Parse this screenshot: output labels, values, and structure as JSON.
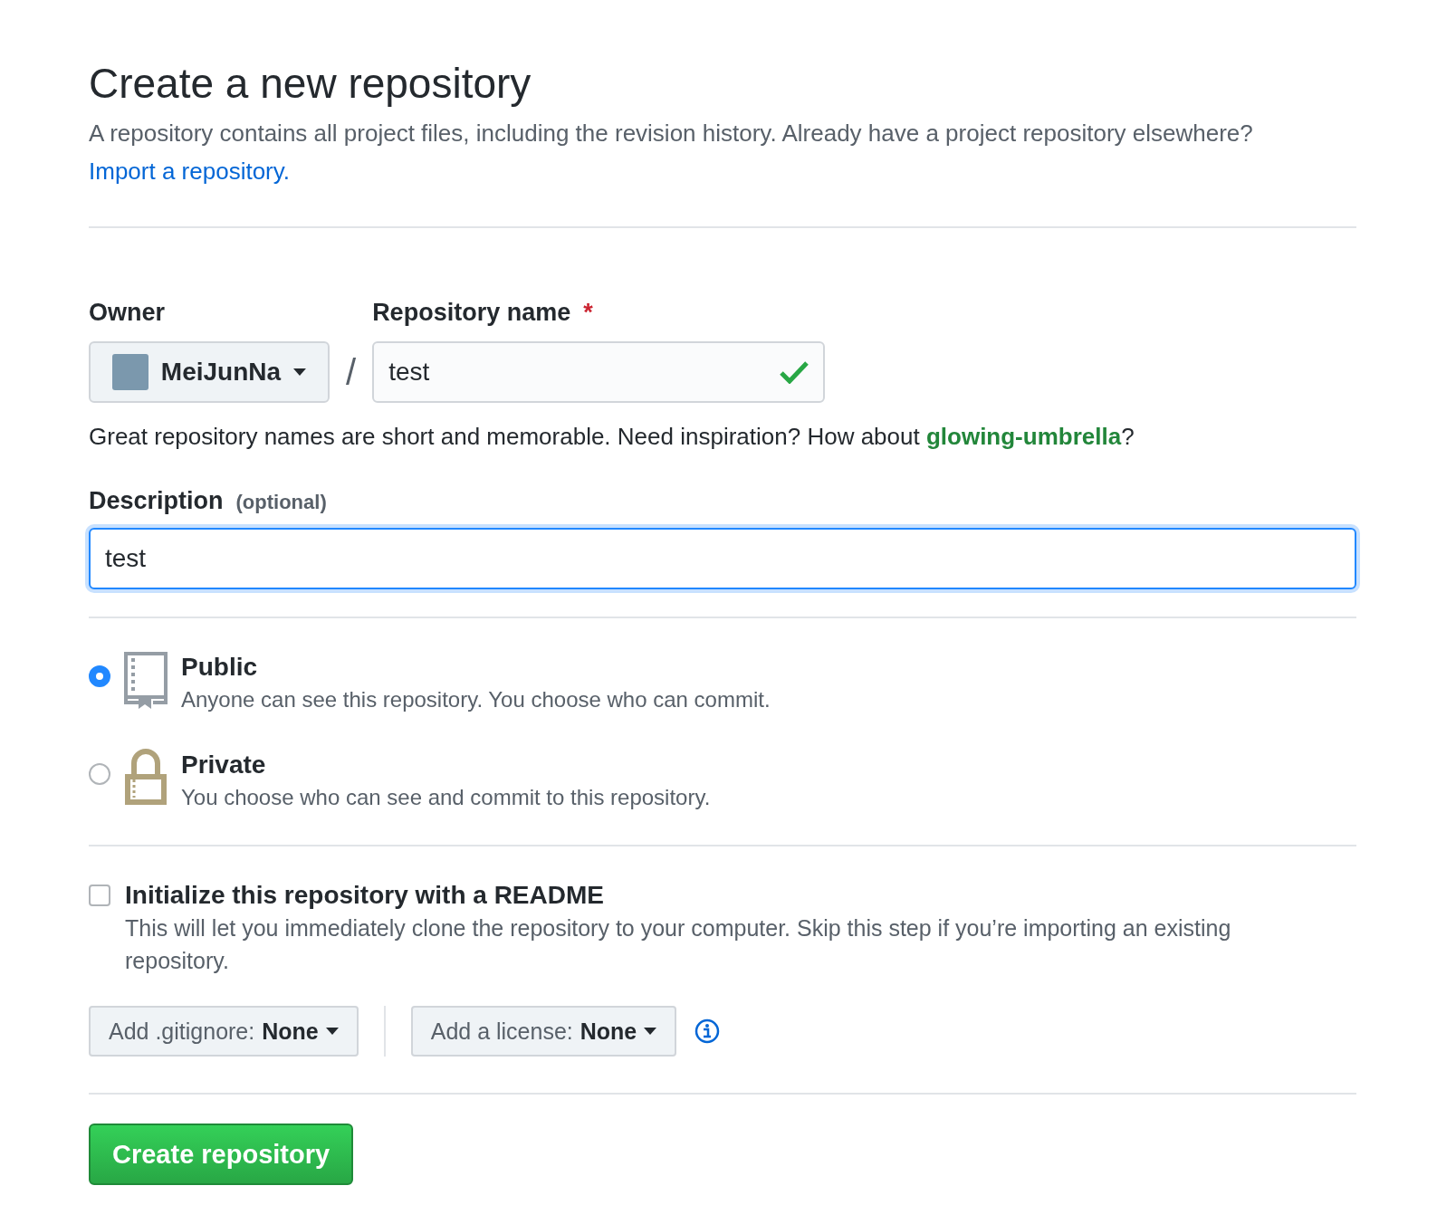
{
  "page": {
    "title": "Create a new repository",
    "intro": "A repository contains all project files, including the revision history. Already have a project repository elsewhere?",
    "import_link": "Import a repository."
  },
  "owner": {
    "label": "Owner",
    "value": "MeiJunNa"
  },
  "separator": "/",
  "repo_name": {
    "label": "Repository name",
    "required_mark": "*",
    "value": "test",
    "valid": true
  },
  "name_hint": "Great repository names are short and memorable. Need inspiration? How about **glowing-umbrella**?",
  "description": {
    "label": "Description",
    "optional_note": "(optional)",
    "value": "test",
    "focused": true
  },
  "visibility": [
    {
      "kind": "public",
      "title": "Public",
      "text": "Anyone can see this repository. You choose who can commit.",
      "selected": true
    },
    {
      "kind": "private",
      "title": "Private",
      "text": "You choose who can see and commit to this repository.",
      "selected": false
    }
  ],
  "readme": {
    "label": "Initialize this repository with a README",
    "text": "This will let you immediately clone the repository to your computer. Skip this step if you’re importing an existing repository.",
    "checked": false
  },
  "dropdowns": [
    {
      "label": "Add .gitignore:",
      "value": "None"
    },
    {
      "label": "Add a license:",
      "value": "None"
    }
  ],
  "create_button": "Create repository"
}
